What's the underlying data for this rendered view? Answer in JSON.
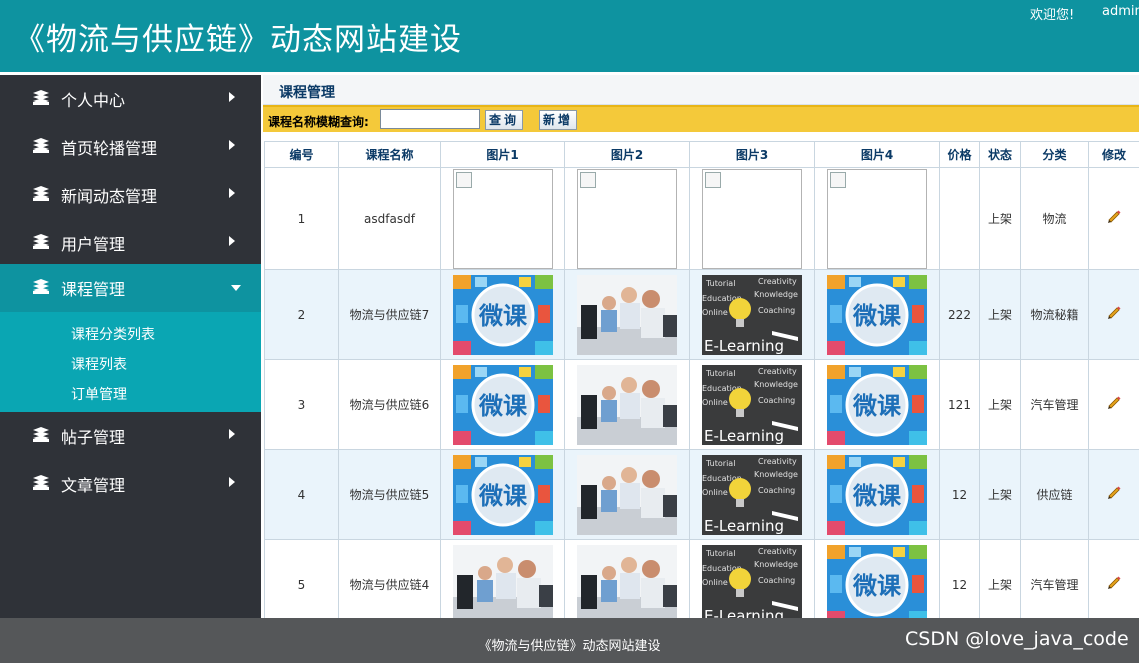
{
  "header": {
    "title": "《物流与供应链》动态网站建设",
    "welcome": "欢迎您!",
    "user": "admin"
  },
  "sidebar": {
    "items": [
      {
        "label": "个人中心"
      },
      {
        "label": "首页轮播管理"
      },
      {
        "label": "新闻动态管理"
      },
      {
        "label": "用户管理"
      },
      {
        "label": "课程管理"
      },
      {
        "label": "帖子管理"
      },
      {
        "label": "文章管理"
      }
    ],
    "active_index": 4,
    "submenu": [
      {
        "label": "课程分类列表"
      },
      {
        "label": "课程列表"
      },
      {
        "label": "订单管理"
      }
    ]
  },
  "content": {
    "title": "课程管理",
    "search": {
      "label": "课程名称模糊查询:",
      "value": "",
      "search_button": "查询",
      "add_button": "新增"
    }
  },
  "table": {
    "columns": [
      "编号",
      "课程名称",
      "图片1",
      "图片2",
      "图片3",
      "图片4",
      "价格",
      "状态",
      "分类",
      "修改"
    ],
    "rows": [
      {
        "id": "1",
        "name": "asdfasdf",
        "pics": [
          "broken",
          "broken",
          "broken",
          "broken"
        ],
        "price": "",
        "status": "上架",
        "category": "物流"
      },
      {
        "id": "2",
        "name": "物流与供应链7",
        "pics": [
          "weike",
          "office",
          "elearning",
          "weike"
        ],
        "price": "222",
        "status": "上架",
        "category": "物流秘籍"
      },
      {
        "id": "3",
        "name": "物流与供应链6",
        "pics": [
          "weike",
          "office",
          "elearning",
          "weike"
        ],
        "price": "121",
        "status": "上架",
        "category": "汽车管理"
      },
      {
        "id": "4",
        "name": "物流与供应链5",
        "pics": [
          "weike",
          "office",
          "elearning",
          "weike"
        ],
        "price": "12",
        "status": "上架",
        "category": "供应链"
      },
      {
        "id": "5",
        "name": "物流与供应链4",
        "pics": [
          "office",
          "office",
          "elearning",
          "weike"
        ],
        "price": "12",
        "status": "上架",
        "category": "汽车管理"
      }
    ],
    "image_text": {
      "weike": "微课",
      "elearning": "E-Learning",
      "elearning_words": [
        "Tutorial",
        "Creativity",
        "Knowledge",
        "Coaching",
        "Education",
        "Online"
      ]
    }
  },
  "footer": {
    "text": "《物流与供应链》动态网站建设",
    "watermark": "CSDN @love_java_code"
  },
  "colors": {
    "header": "#0e93a0",
    "sidebar": "#2f3238",
    "sidebar_active": "#0e93a0",
    "submenu": "#0aa6b3",
    "search_bar": "#f4c93a",
    "row_alt": "#eaf4fb",
    "footer": "#555759"
  }
}
